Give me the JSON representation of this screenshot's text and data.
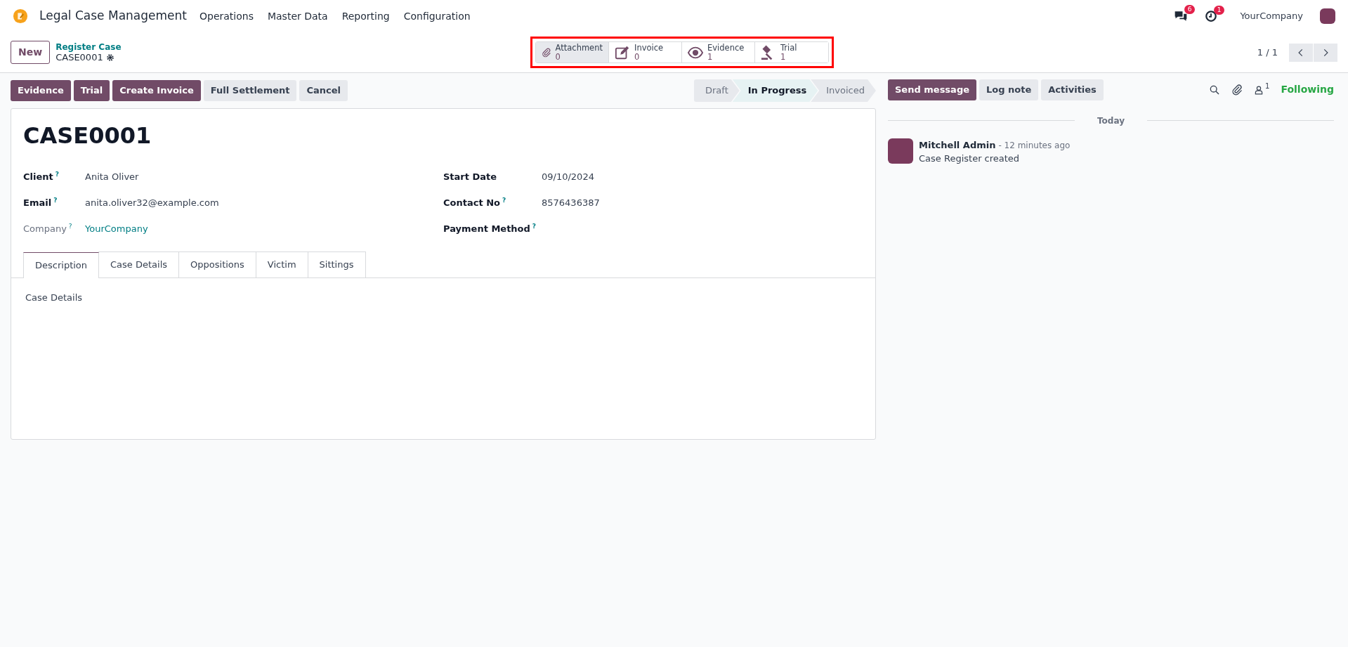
{
  "navbar": {
    "app_name": "Legal Case Management",
    "menus": [
      "Operations",
      "Master Data",
      "Reporting",
      "Configuration"
    ],
    "messages_count": "6",
    "activities_count": "1",
    "company": "YourCompany"
  },
  "control_panel": {
    "new_button": "New",
    "breadcrumb": "Register Case",
    "record_name": "CASE0001",
    "pager": "1 / 1"
  },
  "smart_buttons_highlighted": true,
  "smart_buttons": [
    {
      "kind": "paperclip",
      "label": "Attachment",
      "count": "0",
      "selected": true
    },
    {
      "kind": "edit",
      "label": "Invoice",
      "count": "0",
      "selected": false
    },
    {
      "kind": "eye",
      "label": "Evidence",
      "count": "1",
      "selected": false
    },
    {
      "kind": "gavel",
      "label": "Trial",
      "count": "1",
      "selected": false
    }
  ],
  "action_buttons": [
    {
      "label": "Evidence",
      "primary": true
    },
    {
      "label": "Trial",
      "primary": true
    },
    {
      "label": "Create Invoice",
      "primary": true
    },
    {
      "label": "Full Settlement",
      "primary": false
    },
    {
      "label": "Cancel",
      "primary": false
    }
  ],
  "stages": [
    {
      "label": "Draft",
      "selected": false
    },
    {
      "label": "In Progress",
      "selected": true
    },
    {
      "label": "Invoiced",
      "selected": false
    }
  ],
  "form": {
    "title": "CASE0001",
    "left_fields": [
      {
        "label": "Client",
        "help": "?",
        "value": "Anita Oliver",
        "muted": false,
        "link": false
      },
      {
        "label": "Email",
        "help": "?",
        "value": "anita.oliver32@example.com",
        "muted": false,
        "link": false
      },
      {
        "label": "Company",
        "help": "?",
        "value": "YourCompany",
        "muted": true,
        "link": true
      }
    ],
    "right_fields": [
      {
        "label": "Start Date",
        "value": "09/10/2024",
        "muted": false,
        "link": false
      },
      {
        "label": "Contact No",
        "help": "?",
        "value": "8576436387",
        "muted": false,
        "link": false
      },
      {
        "label": "Payment Method",
        "help": "?",
        "muted": false
      }
    ],
    "tabs": [
      {
        "label": "Description",
        "selected": true
      },
      {
        "label": "Case Details",
        "selected": false
      },
      {
        "label": "Oppositions",
        "selected": false
      },
      {
        "label": "Victim",
        "selected": false
      },
      {
        "label": "Sittings",
        "selected": false
      }
    ],
    "tab_content": "Case Details"
  },
  "chatter": {
    "buttons": [
      {
        "label": "Send message",
        "primary": true
      },
      {
        "label": "Log note",
        "primary": false
      },
      {
        "label": "Activities",
        "primary": false
      }
    ],
    "followers_count": "1",
    "follow_status": "Following",
    "date_separator": "Today",
    "messages": [
      {
        "author": "Mitchell Admin",
        "time": "- 12 minutes ago",
        "body": "Case Register created"
      }
    ]
  }
}
